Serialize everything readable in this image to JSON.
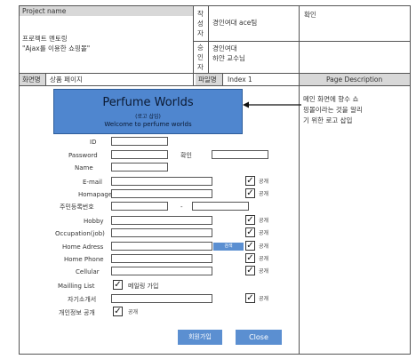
{
  "header": {
    "project_label": "Project name",
    "project_line1": "프로젝트 멘토링",
    "project_line2": "\"Ajax를 이용한 쇼핑몰\"",
    "author_label": [
      "작",
      "성",
      "자"
    ],
    "author_value": "경인여대 ace팀",
    "confirm_label": "확인",
    "approver_label": [
      "승",
      "인",
      "자"
    ],
    "approver_line1": "경인여대",
    "approver_line2": "하얀 교수님",
    "screen_label": "화면명",
    "screen_value": "상품 페이지",
    "file_label": "파일명",
    "file_value": "Index 1",
    "page_desc_label": "Page Description"
  },
  "banner": {
    "title": "Perfume Worlds",
    "subtitle": "(로고 삽입)",
    "welcome": "Welcome to perfume worlds"
  },
  "description": {
    "line1": "메인 화면에 향수 쇼",
    "line2": "핑몰이라는 것을 알리",
    "line3": "기 위한 로고 삽입"
  },
  "form": {
    "id_label": "ID",
    "password_label": "Password",
    "confirm_label": "확인",
    "name_label": "Name",
    "email_label": "E-mail",
    "homepage_label": "Homapage",
    "rrn_label": "주민등록번호",
    "rrn_sep": "-",
    "hobby_label": "Hobby",
    "occupation_label": "Occupation(job)",
    "home_address_label": "Home Adress",
    "address_btn": "검색",
    "home_phone_label": "Home Phone",
    "cellular_label": "Cellular",
    "mailing_label": "Mailling List",
    "mailing_text": "메일링 가입",
    "intro_label": "자기소개서",
    "privacy_label": "개인정보 공개",
    "public_text": "공개",
    "check_mark": "✓",
    "join_button": "회원가입",
    "close_button": "Close"
  }
}
